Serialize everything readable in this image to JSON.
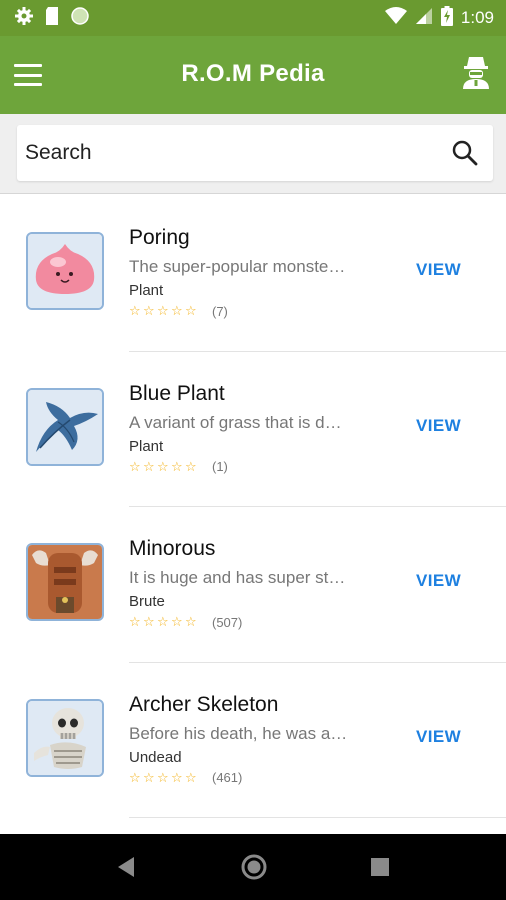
{
  "status_bar": {
    "time": "1:09",
    "icons": [
      "settings-icon",
      "sd-card-icon",
      "circle-icon",
      "wifi-icon",
      "cell-signal-icon",
      "battery-charging-icon"
    ]
  },
  "app_bar": {
    "title": "R.O.M Pedia",
    "left_icon": "menu-icon",
    "right_icon": "user-profile-icon"
  },
  "search": {
    "placeholder": "Search",
    "icon": "search-icon"
  },
  "monsters": [
    {
      "name": "Poring",
      "description": "The super-popular monste…",
      "type": "Plant",
      "rating_count": "(7)",
      "action_label": "VIEW"
    },
    {
      "name": "Blue Plant",
      "description": "A variant of grass that is d…",
      "type": "Plant",
      "rating_count": "(1)",
      "action_label": "VIEW"
    },
    {
      "name": "Minorous",
      "description": "It is huge and has super st…",
      "type": "Brute",
      "rating_count": "(507)",
      "action_label": "VIEW"
    },
    {
      "name": "Archer Skeleton",
      "description": "Before his death, he was a…",
      "type": "Undead",
      "rating_count": "(461)",
      "action_label": "VIEW"
    }
  ],
  "nav_bar": {
    "buttons": [
      "back-icon",
      "home-icon",
      "recents-icon"
    ]
  },
  "colors": {
    "status_bar": "#6a9a30",
    "app_bar": "#6ea53b",
    "accent_link": "#1e80e0",
    "star": "#f3b21a"
  }
}
